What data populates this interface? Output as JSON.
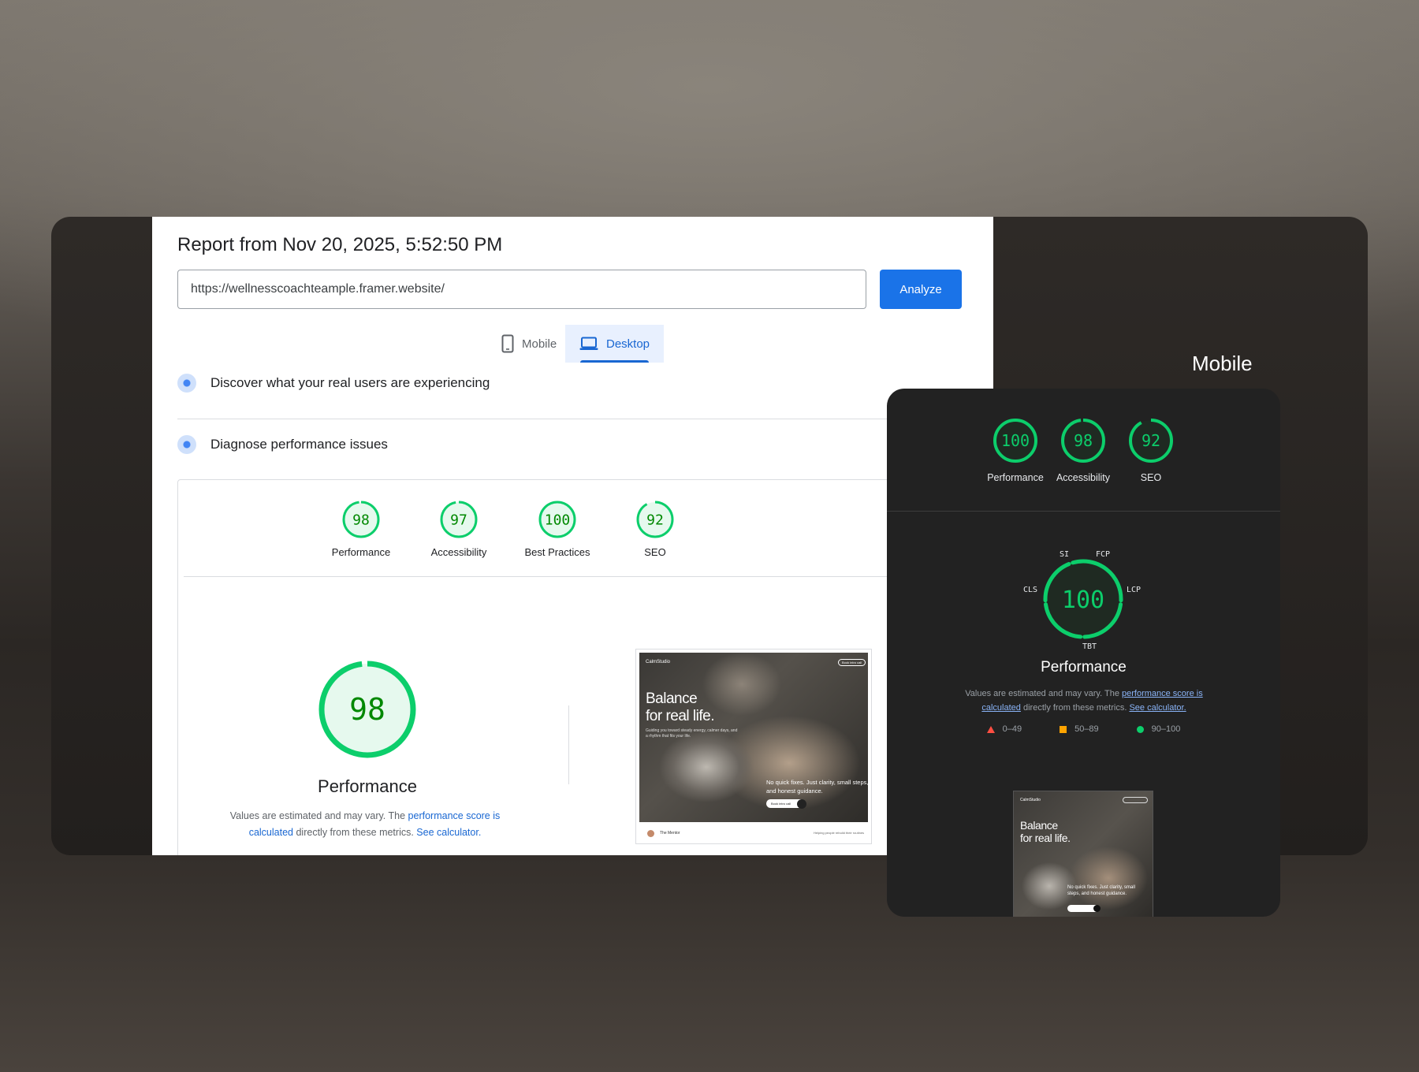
{
  "report": {
    "title": "Report from Nov 20, 2025, 5:52:50 PM",
    "url_value": "https://wellnesscoachteample.framer.website/",
    "analyze_label": "Analyze",
    "tabs": {
      "mobile": "Mobile",
      "desktop": "Desktop"
    },
    "discover_label": "Discover what your real users are experiencing",
    "diagnose_label": "Diagnose performance issues"
  },
  "desktop_scores": [
    {
      "label": "Performance",
      "score": 98
    },
    {
      "label": "Accessibility",
      "score": 97
    },
    {
      "label": "Best Practices",
      "score": 100
    },
    {
      "label": "SEO",
      "score": 92
    }
  ],
  "desktop_performance": {
    "score": 98,
    "title": "Performance",
    "note_pre": "Values are estimated and may vary. The ",
    "note_link1": "performance score is calculated",
    "note_mid": " directly from these metrics. ",
    "note_link2": "See calculator."
  },
  "screenshot": {
    "brand": "CalmStudio",
    "button": "Book intro call",
    "headline_1": "Balance",
    "headline_2": "for real life.",
    "sub": "Guiding you toward steady energy, calmer days, and a rhythm that fits your life.",
    "tagline": "No quick fixes. Just clarity, small steps, and honest guidance.",
    "cta": "Book intro call",
    "footer_left": "The Mentor",
    "footer_right": "Helping people rebuild their routines"
  },
  "mobile": {
    "heading": "Mobile",
    "scores": [
      {
        "label": "Performance",
        "score": 100
      },
      {
        "label": "Accessibility",
        "score": 98
      },
      {
        "label": "SEO",
        "score": 92
      }
    ],
    "performance": {
      "score": 100,
      "title": "Performance"
    },
    "metrics": {
      "si": "SI",
      "fcp": "FCP",
      "cls": "CLS",
      "lcp": "LCP",
      "tbt": "TBT"
    },
    "note_pre": "Values are estimated and may vary. The ",
    "note_link1": "performance score is calculated",
    "note_mid": " directly from these metrics. ",
    "note_link2": "See calculator.",
    "legend": {
      "fail": "0–49",
      "average": "50–89",
      "pass": "90–100"
    },
    "screenshot": {
      "brand": "CalmStudio",
      "headline_1": "Balance",
      "headline_2": "for real life.",
      "tagline": "No quick fixes. Just clarity, small steps, and honest guidance."
    }
  },
  "colors": {
    "pass_green": "#0cce6b",
    "pass_text": "#008800",
    "pass_fill": "#e6f9ee",
    "accent_blue": "#1a73e8",
    "fail_red": "#ff4e42",
    "average_orange": "#ffa400"
  },
  "icons": {
    "mobile_tab": "phone-icon",
    "desktop_tab": "laptop-icon",
    "discover": "users-icon",
    "diagnose": "lighthouse-icon"
  }
}
